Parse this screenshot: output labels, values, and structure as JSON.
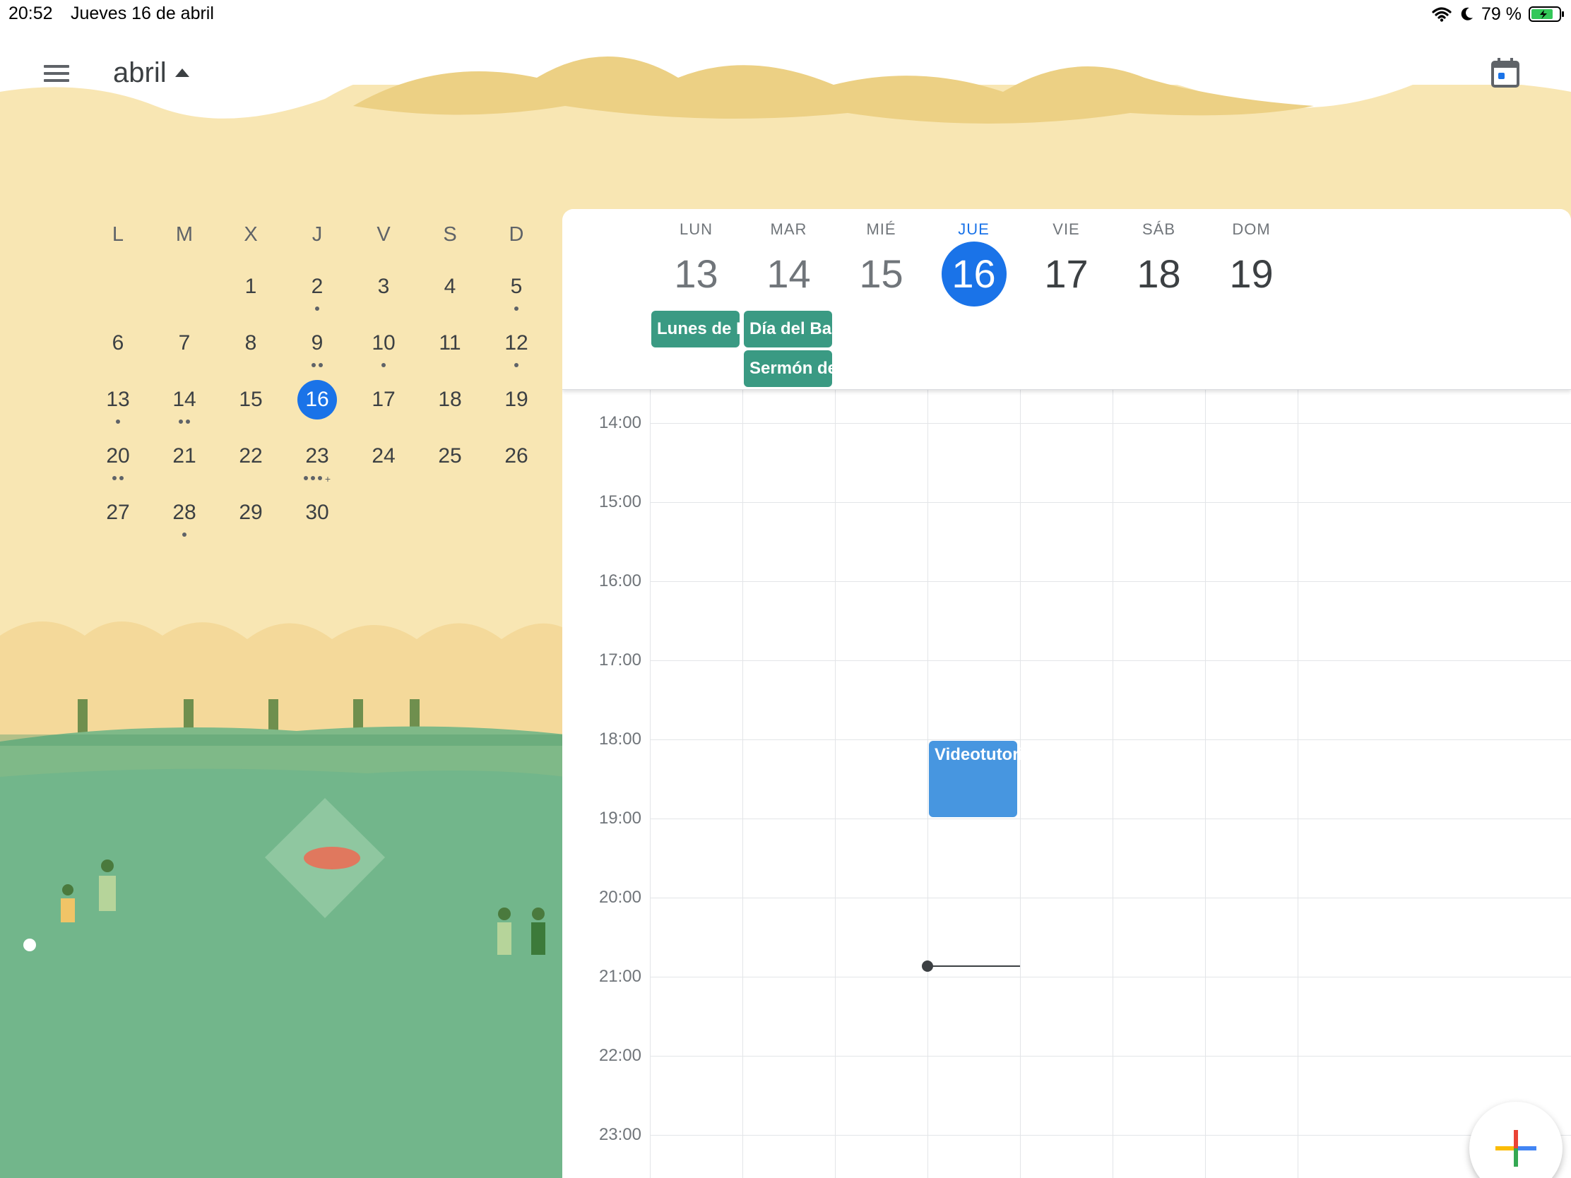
{
  "status_bar": {
    "time": "20:52",
    "date": "Jueves 16 de abril",
    "battery_percent": "79 %",
    "icons": [
      "wifi-icon",
      "moon-icon",
      "battery-icon"
    ]
  },
  "header": {
    "month": "abril",
    "menu_icon": "hamburger-menu-icon",
    "today_icon": "calendar-today-icon"
  },
  "mini_calendar": {
    "weekdays": [
      "L",
      "M",
      "X",
      "J",
      "V",
      "S",
      "D"
    ],
    "leading_blanks": 2,
    "today": 16,
    "days": [
      {
        "n": "1",
        "dots": 0
      },
      {
        "n": "2",
        "dots": 1
      },
      {
        "n": "3",
        "dots": 0
      },
      {
        "n": "4",
        "dots": 0
      },
      {
        "n": "5",
        "dots": 1
      },
      {
        "n": "6",
        "dots": 0
      },
      {
        "n": "7",
        "dots": 0
      },
      {
        "n": "8",
        "dots": 0
      },
      {
        "n": "9",
        "dots": 2
      },
      {
        "n": "10",
        "dots": 1
      },
      {
        "n": "11",
        "dots": 0
      },
      {
        "n": "12",
        "dots": 1
      },
      {
        "n": "13",
        "dots": 1
      },
      {
        "n": "14",
        "dots": 2
      },
      {
        "n": "15",
        "dots": 0
      },
      {
        "n": "16",
        "dots": 0
      },
      {
        "n": "17",
        "dots": 0
      },
      {
        "n": "18",
        "dots": 0
      },
      {
        "n": "19",
        "dots": 0
      },
      {
        "n": "20",
        "dots": 2
      },
      {
        "n": "21",
        "dots": 0
      },
      {
        "n": "22",
        "dots": 0
      },
      {
        "n": "23",
        "dots": 3,
        "more": true
      },
      {
        "n": "24",
        "dots": 0
      },
      {
        "n": "25",
        "dots": 0
      },
      {
        "n": "26",
        "dots": 0
      },
      {
        "n": "27",
        "dots": 0
      },
      {
        "n": "28",
        "dots": 1
      },
      {
        "n": "29",
        "dots": 0
      },
      {
        "n": "30",
        "dots": 0
      }
    ]
  },
  "week": {
    "days": [
      {
        "name": "LUN",
        "num": "13",
        "state": "past"
      },
      {
        "name": "MAR",
        "num": "14",
        "state": "past"
      },
      {
        "name": "MIÉ",
        "num": "15",
        "state": "past"
      },
      {
        "name": "JUE",
        "num": "16",
        "state": "today"
      },
      {
        "name": "VIE",
        "num": "17",
        "state": "future"
      },
      {
        "name": "SÁB",
        "num": "18",
        "state": "future"
      },
      {
        "name": "DOM",
        "num": "19",
        "state": "future"
      }
    ],
    "all_day_events": [
      {
        "title": "Lunes de Pascua",
        "day": 0,
        "row": 0
      },
      {
        "title": "Día del Bando",
        "day": 1,
        "row": 0
      },
      {
        "title": "Sermón de las Tentaciones",
        "day": 1,
        "row": 1
      }
    ],
    "hours": [
      "14:00",
      "15:00",
      "16:00",
      "17:00",
      "18:00",
      "19:00",
      "20:00",
      "21:00",
      "22:00",
      "23:00"
    ],
    "first_hour": 14,
    "events": [
      {
        "title": "Videotutorial",
        "day": 3,
        "start": 18.0,
        "end": 19.0
      }
    ],
    "now": {
      "day": 3,
      "hour": 20.87
    }
  },
  "fab": {
    "icon": "plus-icon"
  },
  "colors": {
    "accent": "#1a73e8",
    "allday_event": "#3a9a83",
    "timed_event": "#4796e0",
    "sand": "#f8e6b3",
    "grass": "#72b68b"
  }
}
